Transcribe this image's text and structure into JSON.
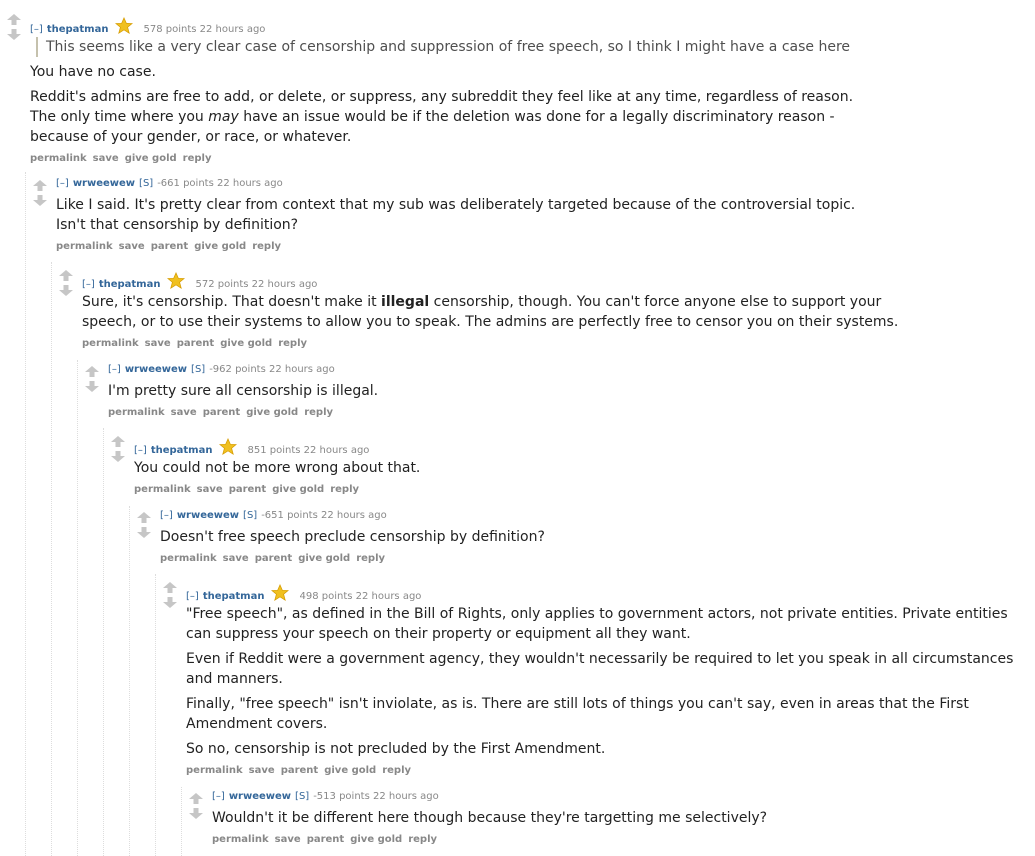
{
  "comments": [
    {
      "collapse": "[–]",
      "author": "thepatman",
      "submitter": "",
      "gilded": true,
      "score_time": "578 points 22 hours ago",
      "quote": "This seems like a very clear case of censorship and suppression of free speech, so I think I might have a case here",
      "p1": "You have no case.",
      "p2": "Reddit's admins are free to add, or delete, or suppress, any subreddit they feel like at any time, regardless of reason.",
      "p3_a": "The only time where you ",
      "p3_em": "may",
      "p3_b": " have an issue would be if the deletion was done for a legally discriminatory reason - because of your gender, or race, or whatever.",
      "buttons": {
        "permalink": "permalink",
        "save": "save",
        "give_gold": "give gold",
        "reply": "reply"
      }
    },
    {
      "collapse": "[–]",
      "author": "wrweewew",
      "submitter": "[S]",
      "score_time": "-661 points 22 hours ago",
      "p1": "Like I said. It's pretty clear from context that my sub was deliberately targeted because of the controversial topic. Isn't that censorship by definition?",
      "buttons": {
        "permalink": "permalink",
        "save": "save",
        "parent": "parent",
        "give_gold": "give gold",
        "reply": "reply"
      }
    },
    {
      "collapse": "[–]",
      "author": "thepatman",
      "gilded": true,
      "score_time": "572 points 22 hours ago",
      "p1_a": "Sure, it's censorship. That doesn't make it ",
      "p1_strong": "illegal",
      "p1_b": " censorship, though. You can't force anyone else to support your speech, or to use their systems to allow you to speak. The admins are perfectly free to censor you on their systems.",
      "buttons": {
        "permalink": "permalink",
        "save": "save",
        "parent": "parent",
        "give_gold": "give gold",
        "reply": "reply"
      }
    },
    {
      "collapse": "[–]",
      "author": "wrweewew",
      "submitter": "[S]",
      "score_time": "-962 points 22 hours ago",
      "p1": "I'm pretty sure all censorship is illegal.",
      "buttons": {
        "permalink": "permalink",
        "save": "save",
        "parent": "parent",
        "give_gold": "give gold",
        "reply": "reply"
      }
    },
    {
      "collapse": "[–]",
      "author": "thepatman",
      "gilded": true,
      "score_time": "851 points 22 hours ago",
      "p1": "You could not be more wrong about that.",
      "buttons": {
        "permalink": "permalink",
        "save": "save",
        "parent": "parent",
        "give_gold": "give gold",
        "reply": "reply"
      }
    },
    {
      "collapse": "[–]",
      "author": "wrweewew",
      "submitter": "[S]",
      "score_time": "-651 points 22 hours ago",
      "p1": "Doesn't free speech preclude censorship by definition?",
      "buttons": {
        "permalink": "permalink",
        "save": "save",
        "parent": "parent",
        "give_gold": "give gold",
        "reply": "reply"
      }
    },
    {
      "collapse": "[–]",
      "author": "thepatman",
      "gilded": true,
      "score_time": "498 points 22 hours ago",
      "p1": "\"Free speech\", as defined in the Bill of Rights, only applies to government actors, not private entities. Private entities can suppress your speech on their property or equipment all they want.",
      "p2": "Even if Reddit were a government agency, they wouldn't necessarily be required to let you speak in all circumstances and manners.",
      "p3": "Finally, \"free speech\" isn't inviolate, as is. There are still lots of things you can't say, even in areas that the First Amendment covers.",
      "p4": "So no, censorship is not precluded by the First Amendment.",
      "buttons": {
        "permalink": "permalink",
        "save": "save",
        "parent": "parent",
        "give_gold": "give gold",
        "reply": "reply"
      }
    },
    {
      "collapse": "[–]",
      "author": "wrweewew",
      "submitter": "[S]",
      "score_time": "-513 points 22 hours ago",
      "p1": "Wouldn't it be different here though because they're targetting me selectively?",
      "buttons": {
        "permalink": "permalink",
        "save": "save",
        "parent": "parent",
        "give_gold": "give gold",
        "reply": "reply"
      }
    }
  ],
  "colors": {
    "author": "#336699",
    "meta": "#888888",
    "arrow": "#c6c6c6",
    "gold_star": "#f0c020"
  }
}
